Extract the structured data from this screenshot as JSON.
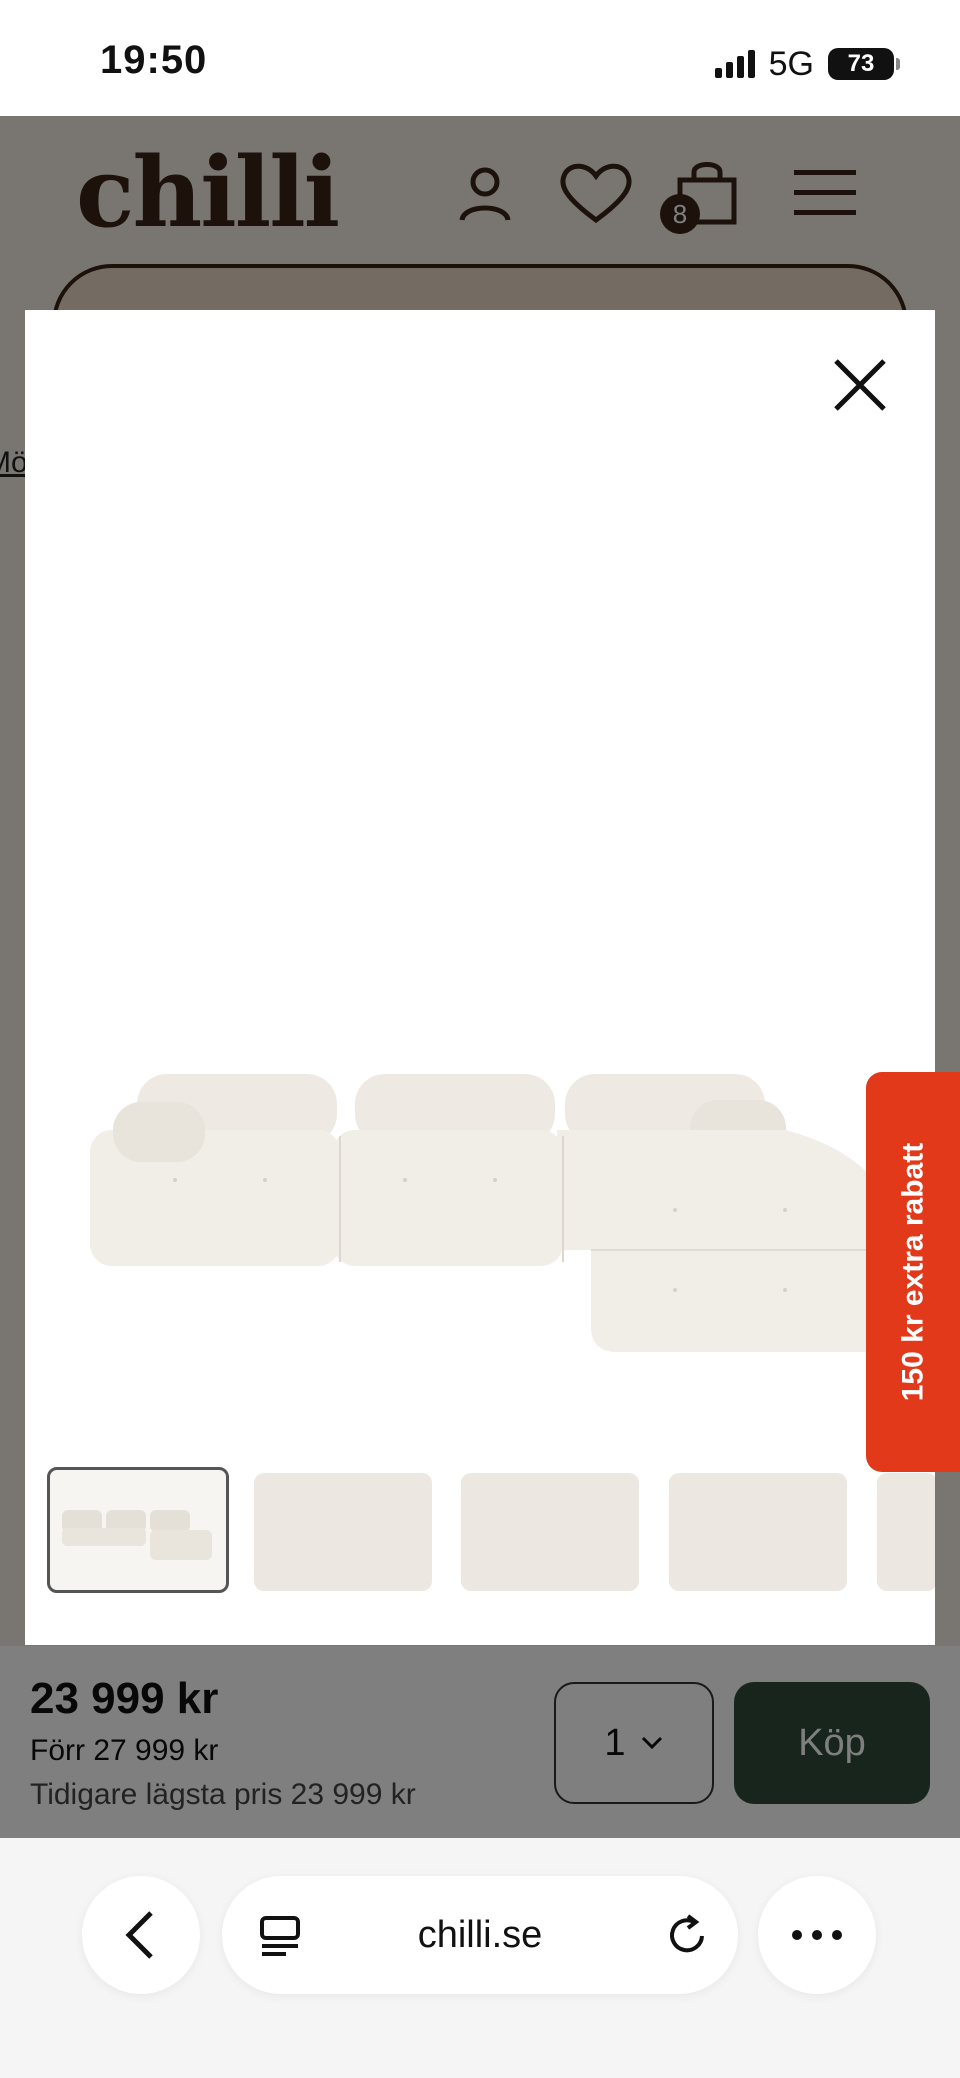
{
  "status_bar": {
    "time": "19:50",
    "network": "5G",
    "battery": "73"
  },
  "site": {
    "logo": "chilli",
    "cart_count": "8",
    "side_link": "Mö"
  },
  "modal": {
    "product_image_alt": "White modular bouclé corner sofa",
    "thumbnails": 5,
    "active_thumbnail": 1
  },
  "promo": {
    "label": "150 kr extra rabatt"
  },
  "buy_bar": {
    "price": "23 999 kr",
    "was_price": "Förr 27 999 kr",
    "lowest_price": "Tidigare lägsta pris 23 999 kr",
    "quantity": "1",
    "buy_label": "Köp"
  },
  "browser": {
    "url": "chilli.se"
  },
  "colors": {
    "brand_brown": "#3a2416",
    "buy_green": "#2e4a3a",
    "promo_red": "#e2391b"
  },
  "icons": [
    "user-icon",
    "heart-icon",
    "cart-icon",
    "menu-icon",
    "close-icon",
    "chevron-down-icon",
    "back-icon",
    "tabs-icon",
    "reload-icon",
    "more-icon"
  ]
}
